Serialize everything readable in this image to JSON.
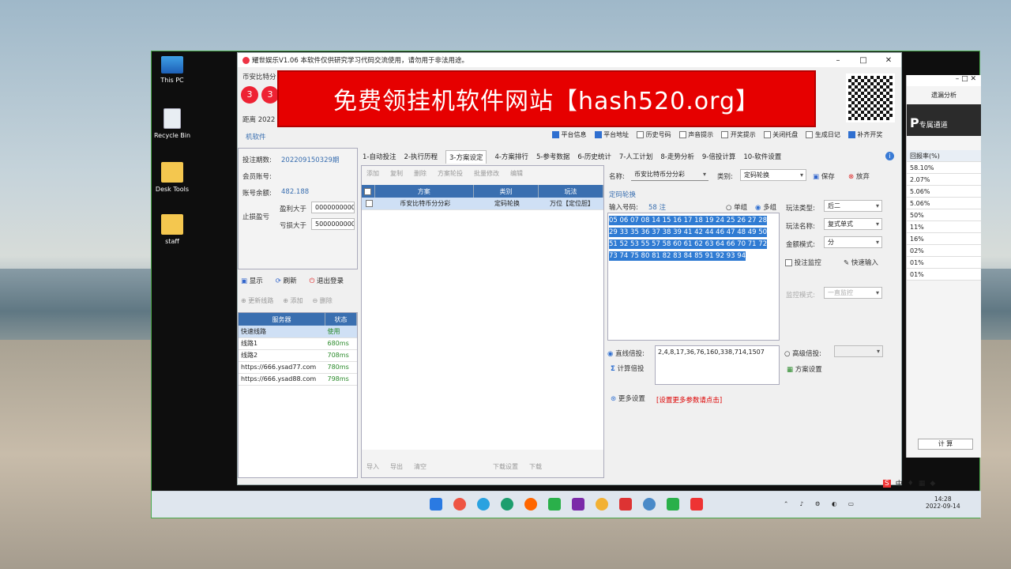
{
  "desktop": {
    "icons": [
      {
        "label": "This PC",
        "icon": "monitor-icon"
      },
      {
        "label": "Recycle Bin",
        "icon": "recycle-bin-icon"
      },
      {
        "label": "Desk Tools",
        "icon": "folder-icon"
      },
      {
        "label": "staff",
        "icon": "folder-icon"
      }
    ]
  },
  "app": {
    "title": "耀世娱乐V1.06 本软件仅供研究学习代码交流使用，请勿用于非法用途。",
    "banner": "免费领挂机软件网站【hash520.org】",
    "brand_line": "币安比特分",
    "badges": [
      "3",
      "3"
    ],
    "countdown_label": "距离 2022",
    "right_header": "遗漏分析",
    "right_brand": "专属通道",
    "right_col": "回报率(%)",
    "right_rows": [
      "58.10%",
      "2.07%",
      "5.06%",
      "5.06%",
      "50%",
      "11%",
      "16%",
      "02%",
      "01%",
      "01%"
    ],
    "right_calc": "计 算",
    "options": [
      {
        "label": "平台信息",
        "checked": true
      },
      {
        "label": "平台地址",
        "checked": true
      },
      {
        "label": "历史号码",
        "checked": false
      },
      {
        "label": "声音提示",
        "checked": false
      },
      {
        "label": "开奖提示",
        "checked": false
      },
      {
        "label": "关闭托盘",
        "checked": false
      },
      {
        "label": "生成日记",
        "checked": false
      },
      {
        "label": "补齐开奖",
        "checked": true
      }
    ],
    "software_label": "机软件",
    "left": {
      "period_label": "投注期数:",
      "period_value": "202209150329期",
      "account_label": "会员账号:",
      "balance_label": "账号余额:",
      "balance_value": "482.188",
      "stop_label": "止损盈亏",
      "profit_label": "盈利大于",
      "profit_value": "00000000000",
      "loss_label": "亏损大于",
      "loss_value": "50000000000",
      "btn_show": "显示",
      "btn_refresh": "刷新",
      "btn_logout": "退出登录",
      "btn_update_line": "更新线路",
      "btn_add": "添加",
      "btn_delete": "删除",
      "server_col": "服务器",
      "status_col": "状态",
      "servers": [
        {
          "name": "快速线路",
          "status": "使用"
        },
        {
          "name": "线路1",
          "status": "680ms"
        },
        {
          "name": "线路2",
          "status": "708ms"
        },
        {
          "name": "https://666.ysad77.com",
          "status": "780ms"
        },
        {
          "name": "https://666.ysad88.com",
          "status": "798ms"
        }
      ]
    },
    "tabs": [
      "1-自动投注",
      "2-执行历程",
      "3-方案设定",
      "4-方案排行",
      "5-参考数据",
      "6-历史统计",
      "7-人工计划",
      "8-走势分析",
      "9-倍投计算",
      "10-软件设置"
    ],
    "plan_toolbar": [
      "添加",
      "复制",
      "删除",
      "方案轮投",
      "批量修改",
      "编辑"
    ],
    "plan_cols": [
      "方案",
      "类别",
      "玩法"
    ],
    "plan_rows": [
      {
        "name": "币安比特币分分彩",
        "type": "定码轮换",
        "play": "万位【定位胆】"
      }
    ],
    "plan_bottom": [
      "导入",
      "导出",
      "清空",
      "下载设置",
      "下载"
    ],
    "form": {
      "name_label": "名称:",
      "name_value": "币安比特币分分彩",
      "type_label": "类别:",
      "type_value": "定码轮换",
      "save": "保存",
      "abandon": "放弃",
      "section": "定码轮换",
      "input_label": "输入号码:",
      "count": "58 注",
      "single": "单组",
      "multi": "多组",
      "numbers": "05 06 07 08 14 15 16 17 18 19 24 25 26 27 28 29 33 35 36 37 38 39 41 42 44 46 47 48 49 50 51 52 53 55 57 58 60 61 62 63 64 66 70 71 72 73 74 75 80 81 82 83 84 85 91 92 93 94",
      "play_type_label": "玩法类型:",
      "play_type": "后二",
      "play_name_label": "玩法名称:",
      "play_name": "复式单式",
      "money_label": "金额模式:",
      "money": "分",
      "monitor": "投注监控",
      "quick": "快速输入",
      "monitor_mode_label": "监控模式:",
      "monitor_mode": "一直监控",
      "linear_label": "直线倍投:",
      "linear_value": "2,4,8,17,36,76,160,338,714,1507",
      "adv_label": "高级倍投:",
      "calc": "计算倍投",
      "plan_set": "方案设置",
      "more": "更多设置",
      "more_hint": "[设置更多参数请点击]"
    }
  },
  "taskbar": {
    "time": "14:28",
    "date": "2022-09-14",
    "ime": "中"
  }
}
